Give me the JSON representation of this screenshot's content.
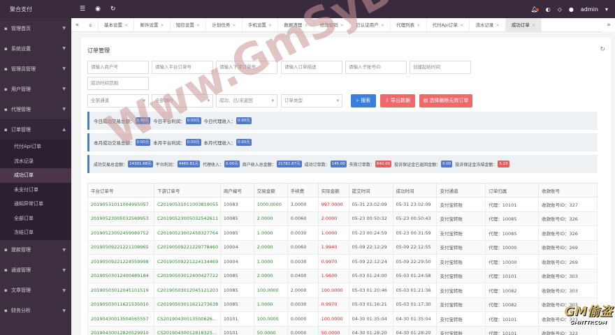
{
  "app": {
    "brand": "聚合支付",
    "user": "admin"
  },
  "topbar": {
    "icons": [
      "menu-icon",
      "globe-icon",
      "refresh-icon"
    ],
    "right_icons": [
      "bell-icon",
      "palette-icon",
      "tag-icon",
      "user-icon"
    ]
  },
  "sidebar": {
    "items": [
      {
        "label": "管理首页",
        "icon": "home-icon"
      },
      {
        "label": "系统设置",
        "icon": "gear-icon"
      },
      {
        "label": "管理员管理",
        "icon": "admin-icon"
      },
      {
        "label": "用户管理",
        "icon": "user-icon"
      },
      {
        "label": "代理管理",
        "icon": "agent-icon"
      },
      {
        "label": "订单管理",
        "icon": "order-icon"
      }
    ],
    "sub_items": [
      "代付Api订单",
      "流水记录",
      "成功订单",
      "未支付订单",
      "通知异常订单",
      "全部订单",
      "冻结订单"
    ],
    "active_sub": "成功订单",
    "bottom_items": [
      {
        "label": "提款管理",
        "icon": "withdraw-icon"
      },
      {
        "label": "通道管理",
        "icon": "channel-icon"
      },
      {
        "label": "文章管理",
        "icon": "article-icon"
      },
      {
        "label": "财务分析",
        "icon": "finance-icon"
      }
    ]
  },
  "tabs": [
    "基本设置",
    "邮件设置",
    "短信设置",
    "计划任务",
    "手机设置",
    "数据清理",
    "修改密码",
    "已认证用户",
    "代理列表",
    "代付Api订单",
    "流水记录",
    "成功订单"
  ],
  "active_tab": "成功订单",
  "page": {
    "title": "订单管理"
  },
  "filters": {
    "merchant_no": "请输入商户号",
    "platform_order": "请输入平台订单号",
    "downstream_order": "请输入下游订单号",
    "order_desc": "请输入订单描述",
    "sub_account": "请输入子账号ID",
    "create_time": "创建起始时间",
    "success_time": "成功时间范围",
    "channel": "全部通道",
    "bank": "全部银行",
    "status": "成功、已/未返回",
    "order_type": "订单类型",
    "search_btn": "搜索",
    "export_btn": "导出数据",
    "delete_btn": "选择删除无效订单"
  },
  "stats": {
    "today_label": "今日成功交易总额：",
    "today_value": "0.00元",
    "today_profit_label": "今日平台利润：",
    "today_profit_value": "0.00元",
    "today_agent_label": "今日代理收入：",
    "today_agent_value": "0.00元",
    "month_label": "本月成功交易总额：",
    "month_value": "0.00元",
    "month_profit_label": "本月平台利润：",
    "month_profit_value": "0.00元",
    "month_agent_label": "本月代理收入：",
    "month_agent_value": "0.00元",
    "total_label": "成功交易总金额：",
    "total_value": "24301.68元",
    "platform_profit_label": "平台利润：",
    "platform_profit_value": "4460.81元",
    "agent_income_label": "代理收入：",
    "agent_income_value": "0.00元",
    "merchant_income_label": "商户收入总金额：",
    "merchant_income_value": "21782.87元",
    "success_count_label": "成功订单数：",
    "success_count_value": "145.00",
    "fail_count_label": "失败订单数：",
    "fail_count_value": "640.00",
    "deposit_returned_label": "投诉保证金已返回金额：",
    "deposit_returned_value": "0.00",
    "deposit_frozen_label": "投诉保证金冻结金额：",
    "deposit_frozen_value": "5.23"
  },
  "table": {
    "headers": [
      "平台订单号",
      "下游订单号",
      "商户编号",
      "交易金额",
      "手续费",
      "实际金额",
      "提交时间",
      "成功时间",
      "支付通道",
      "订单归属",
      "收款账号"
    ],
    "rows": [
      [
        "20190531011004995057",
        "C20190531011003819055",
        "10083",
        "1000.0000",
        "3.0000",
        "997.0000",
        "05-31 23:02:09",
        "05-31 23:02:09",
        "支付宝转账",
        "代理：10101",
        "收款账号ID：327"
      ],
      [
        "20190523005032569953",
        "C20190523005032542611",
        "10085",
        "2.0000",
        "0.0060",
        "2.0000",
        "05-23 00:50:32",
        "05-23 00:50:43",
        "支付宝转账",
        "代理：10085",
        "收款账号ID：326"
      ],
      [
        "20190523002459989752",
        "C20190523002458327764",
        "10085",
        "1.0000",
        "0.0030",
        "1.0000",
        "05-23 00:24:59",
        "05-23 00:31:59",
        "支付宝转账",
        "代理：10085",
        "收款账号ID：326"
      ],
      [
        "20190509221221108965",
        "C20190509221229778460",
        "10004",
        "2.0000",
        "0.0060",
        "1.9940",
        "05-09 22:12:29",
        "05-09 22:12:55",
        "支付宝转账",
        "代理：10000",
        "收款账号ID：269"
      ],
      [
        "20190509221224559998",
        "C20190509221224134469",
        "10004",
        "1.0000",
        "0.0030",
        "0.9970",
        "05-09 22:12:24",
        "05-09 22:29:50",
        "支付宝转账",
        "代理：10000",
        "收款账号ID：269"
      ],
      [
        "20190503012400489184",
        "C20190503012400427722",
        "10085",
        "2.0000",
        "0.0400",
        "1.9600",
        "05-03 01:24:00",
        "05-03 01:24:58",
        "支付宝转账",
        "代理：10101",
        "收款账号ID：303"
      ],
      [
        "20190503012045101519",
        "C20190503012045121203",
        "10085",
        "100.0000",
        "2.0000",
        "100.0000",
        "05-03 01:20:46",
        "05-03 01:21:36",
        "支付宝转账",
        "代理：10082",
        "收款账号ID：303"
      ],
      [
        "20190503011621535010",
        "C20190503011621273638",
        "10085",
        "1.0000",
        "0.0030",
        "0.9970",
        "05-03 01:16:21",
        "05-03 01:17:30",
        "支付宝转账",
        "代理：10082",
        "收款账号ID：303"
      ],
      [
        "20190430013504565557",
        "CS20190430013500626...",
        "10101",
        "100.0000",
        "0.0000",
        "100.0000",
        "04-30 01:35:04",
        "04-30 01:35:04",
        "支付宝转账",
        "代理：10101",
        "收款账号ID：323"
      ],
      [
        "20190430012820529910",
        "CS20190430012818325...",
        "10101",
        "50.0000",
        "0.0000",
        "50.0000",
        "04-30 01:28:20",
        "04-30 01:28:20",
        "支付宝转账",
        "代理：10101",
        "收款账号ID：323"
      ]
    ]
  },
  "watermark": {
    "text": "Www.GmSyBB.Com",
    "logo": "GM偷盗",
    "logo_sub": "GMHTTP.COM"
  }
}
